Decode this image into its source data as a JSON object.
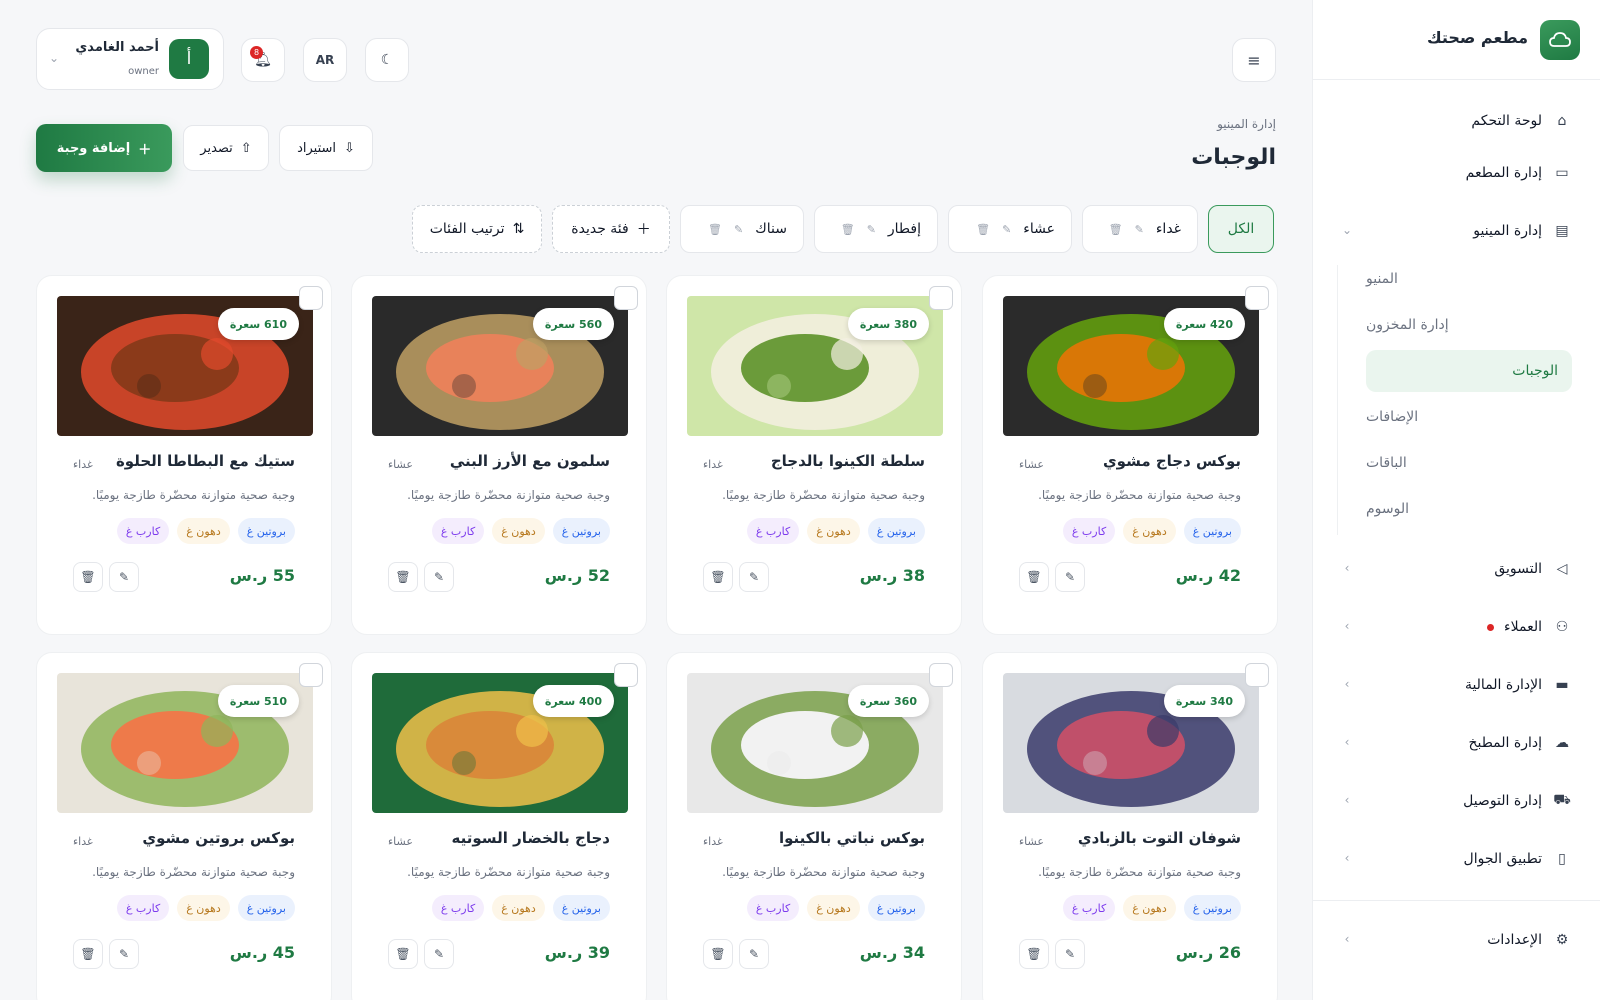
{
  "sidebar": {
    "brand_name": "مطعم صحتك",
    "items": [
      {
        "label": "لوحة التحكم",
        "icon": "home-icon"
      },
      {
        "label": "إدارة المطعم",
        "icon": "store-icon"
      },
      {
        "label": "إدارة المينيو",
        "icon": "document-icon"
      },
      {
        "label": "التسويق",
        "icon": "megaphone-icon"
      },
      {
        "label": "العملاء",
        "icon": "users-icon"
      },
      {
        "label": "الإدارة المالية",
        "icon": "credit-card-icon"
      },
      {
        "label": "إدارة المطبخ",
        "icon": "chef-hat-icon"
      },
      {
        "label": "إدارة التوصيل",
        "icon": "truck-icon"
      },
      {
        "label": "تطبيق الجوال",
        "icon": "phone-icon"
      },
      {
        "label": "الإعدادات",
        "icon": "gear-icon"
      }
    ],
    "submenu": [
      "المنيو",
      "إدارة المخزون",
      "الوجبات",
      "الإضافات",
      "الباقات",
      "الوسوم"
    ]
  },
  "header": {
    "user_name": "أحمد الغامدي",
    "user_role": "owner",
    "avatar_letter": "أ",
    "notification_count": "8",
    "lang": "AR"
  },
  "page": {
    "breadcrumb": "إدارة المينيو",
    "title": "الوجبات",
    "add_label": "إضافة وجبة",
    "export_label": "تصدير",
    "import_label": "استيراد"
  },
  "categories": {
    "all": "الكل",
    "list": [
      "غداء",
      "عشاء",
      "إفطار",
      "سناك"
    ],
    "new_label": "فئة جديدة",
    "sort_label": "ترتيب الفئات"
  },
  "meals": [
    {
      "name": "بوكس دجاج مشوي",
      "category": "عشاء",
      "kcal": "420 سعرة",
      "price": "42 ر.س"
    },
    {
      "name": "سلطة الكينوا بالدجاج",
      "category": "غداء",
      "kcal": "380 سعرة",
      "price": "38 ر.س"
    },
    {
      "name": "سلمون مع الأرز البني",
      "category": "عشاء",
      "kcal": "560 سعرة",
      "price": "52 ر.س"
    },
    {
      "name": "ستيك مع البطاطا الحلوة",
      "category": "غداء",
      "kcal": "610 سعرة",
      "price": "55 ر.س"
    },
    {
      "name": "شوفان التوت بالزبادي",
      "category": "عشاء",
      "kcal": "340 سعرة",
      "price": "26 ر.س"
    },
    {
      "name": "بوكس نباتي بالكينوا",
      "category": "غداء",
      "kcal": "360 سعرة",
      "price": "34 ر.س"
    },
    {
      "name": "دجاج بالخضار السوتيه",
      "category": "عشاء",
      "kcal": "400 سعرة",
      "price": "39 ر.س"
    },
    {
      "name": "بوكس بروتين مشوي",
      "category": "غداء",
      "kcal": "510 سعرة",
      "price": "45 ر.س"
    }
  ],
  "meal_common": {
    "description": "وجبة صحية متوازنة محضّرة طازجة يوميًا.",
    "tags": [
      "بروتين غ",
      "دهون غ",
      "كارب غ"
    ]
  },
  "colors": {
    "accent": "#1f7a43",
    "accent_light": "#eaf5ee",
    "danger": "#dc2626"
  }
}
